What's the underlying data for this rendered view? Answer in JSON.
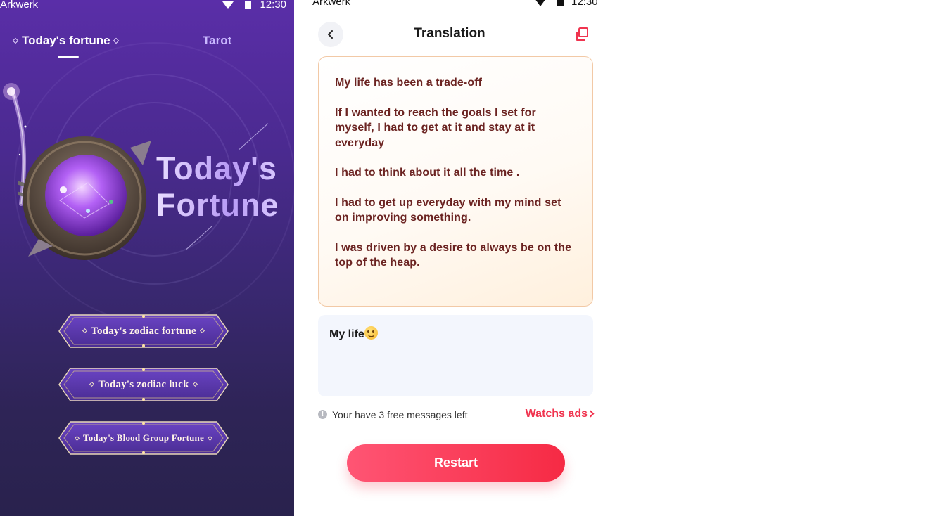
{
  "fortune_screen": {
    "status_bar": {
      "carrier": "Arkwerk",
      "time": "12:30"
    },
    "tabs": {
      "active": "Today's fortune",
      "inactive": "Tarot"
    },
    "hero": {
      "line1_part1": "Toda",
      "line1_part2": "y's",
      "line2": "Fortune"
    },
    "buttons": [
      {
        "label": "Today's zodiac fortune"
      },
      {
        "label": "Today's zodiac luck"
      },
      {
        "label": "Today's Blood Group Fortune"
      }
    ]
  },
  "translation_screen": {
    "status_bar": {
      "carrier": "Arkwerk",
      "time": "12:30"
    },
    "header": {
      "title": "Translation"
    },
    "result_paragraphs": [
      "My life has been a trade-off",
      "If I wanted to reach the goals I set for myself, I had to get at it and stay at it everyday",
      "I had to think about it all the time .",
      "I had to get up everyday with my mind set on improving something.",
      "I was driven by a desire to always be on the top of the heap."
    ],
    "input": {
      "text": "My life"
    },
    "info": {
      "message": "Your have 3 free messages left",
      "watch_ads": "Watchs ads"
    },
    "restart_label": "Restart",
    "colors": {
      "accent": "#f0344f",
      "result_text": "#6b2321",
      "card_border": "#f2c9a6",
      "input_bg": "#f3f6fd"
    }
  }
}
